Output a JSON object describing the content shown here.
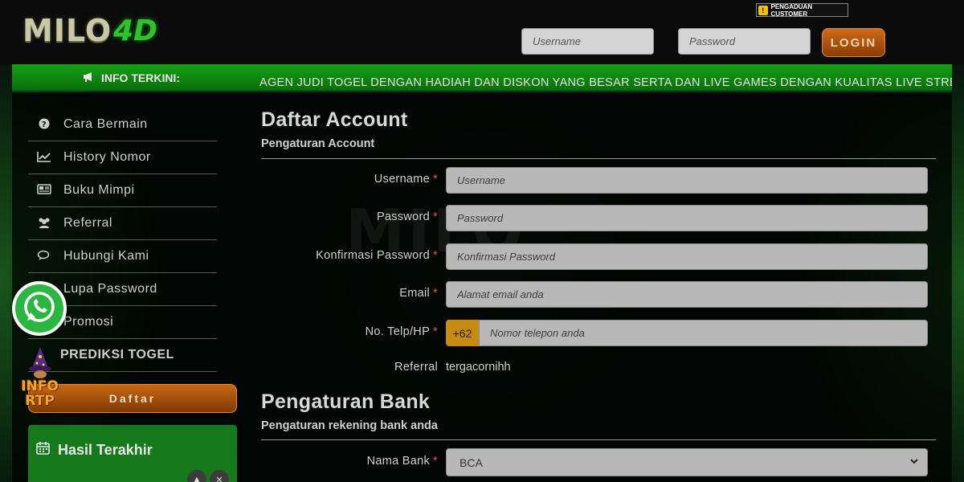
{
  "brand": {
    "logo_main": "MILO",
    "logo_accent": "4D"
  },
  "header": {
    "complaint_label": "PENGADUAN CUSTOMER",
    "username_placeholder": "Username",
    "password_placeholder": "Password",
    "login_label": "LOGIN"
  },
  "ticker": {
    "label": "INFO TERKINI:",
    "text": "AGEN JUDI TOGEL DENGAN HADIAH DAN DISKON YANG BESAR SERTA DAN LIVE GAMES DENGAN KUALITAS LIVE STREAMIN"
  },
  "sidebar": {
    "items": [
      {
        "label": "Cara Bermain",
        "icon": "question-circle-icon"
      },
      {
        "label": "History Nomor",
        "icon": "line-chart-icon"
      },
      {
        "label": "Buku Mimpi",
        "icon": "newspaper-icon"
      },
      {
        "label": "Referral",
        "icon": "users-icon"
      },
      {
        "label": "Hubungi Kami",
        "icon": "chat-icon"
      },
      {
        "label": "Lupa Password",
        "icon": "key-icon"
      },
      {
        "label": "Promosi",
        "icon": "gift-icon"
      },
      {
        "label": "PREDIKSI TOGEL",
        "icon": ""
      }
    ],
    "daftar_label": "Daftar",
    "hasil_title": "Hasil Terakhir"
  },
  "badges": {
    "rtp_line1": "INFO",
    "rtp_line2": "RTP"
  },
  "account": {
    "title": "Daftar Account",
    "subtitle": "Pengaturan Account",
    "fields": {
      "username": {
        "label": "Username",
        "placeholder": "Username"
      },
      "password": {
        "label": "Password",
        "placeholder": "Password"
      },
      "confirm": {
        "label": "Konfirmasi Password",
        "placeholder": "Konfirmasi Password"
      },
      "email": {
        "label": "Email",
        "placeholder": "Alamat email anda"
      },
      "phone": {
        "label": "No. Telp/HP",
        "prefix": "+62",
        "placeholder": "Nomor telepon anda"
      },
      "referral": {
        "label": "Referral",
        "value": "tergacornihh"
      }
    },
    "required_mark": "*"
  },
  "bank": {
    "title": "Pengaturan Bank",
    "subtitle": "Pengaturan rekening bank anda",
    "bank_name_label": "Nama Bank",
    "bank_name_value": "BCA"
  },
  "colors": {
    "accent_green": "#16a016",
    "button_orange": "#c86714",
    "required_red": "#d9534f",
    "phone_prefix": "#c78b12"
  }
}
